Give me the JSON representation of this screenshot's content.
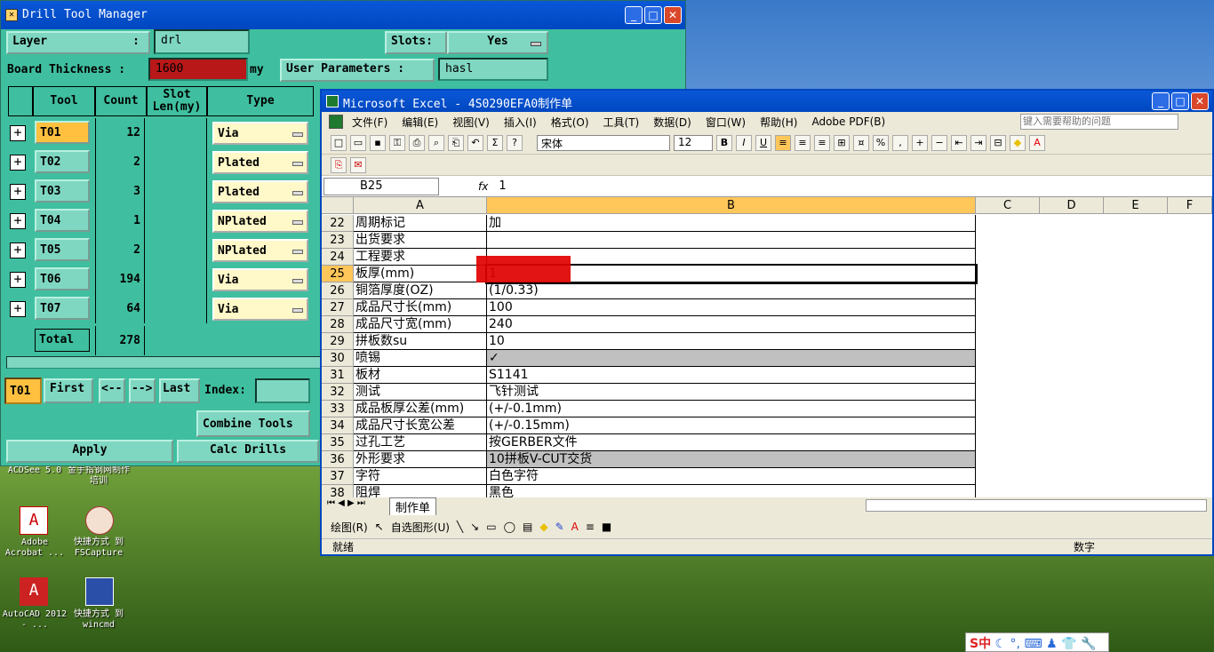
{
  "desktop": {
    "icons": [
      {
        "label": "ACDSee 5.0"
      },
      {
        "label": "金手指钢网制作培训"
      },
      {
        "label": "Adobe Acrobat ..."
      },
      {
        "label": "快捷方式 到 FSCapture"
      },
      {
        "label": "AutoCAD 2012 - ..."
      },
      {
        "label": "快捷方式 到 wincmd"
      }
    ],
    "tray": "S中"
  },
  "drill": {
    "title": "Drill Tool Manager",
    "layer_label": "Layer",
    "layer_sep": ":",
    "layer_value": "drl",
    "slots_label": "Slots:",
    "slots_value": "Yes",
    "thickness_label": "Board Thickness :",
    "thickness_value": "1600",
    "thickness_unit": "my",
    "user_params_label": "User Parameters :",
    "user_params_value": "hasl",
    "headers": {
      "tool": "Tool",
      "count": "Count",
      "slot": "Slot Len(my)",
      "type": "Type"
    },
    "rows": [
      {
        "tool": "T01",
        "count": "12",
        "type": "Via"
      },
      {
        "tool": "T02",
        "count": "2",
        "type": "Plated"
      },
      {
        "tool": "T03",
        "count": "3",
        "type": "Plated"
      },
      {
        "tool": "T04",
        "count": "1",
        "type": "NPlated"
      },
      {
        "tool": "T05",
        "count": "2",
        "type": "NPlated"
      },
      {
        "tool": "T06",
        "count": "194",
        "type": "Via"
      },
      {
        "tool": "T07",
        "count": "64",
        "type": "Via"
      }
    ],
    "total_label": "Total",
    "total_count": "278",
    "current_tool": "T01",
    "nav": {
      "first": "First",
      "prev": "<--",
      "next": "-->",
      "last": "Last",
      "index_label": "Index:"
    },
    "combine": "Combine Tools",
    "apply": "Apply",
    "calc": "Calc Drills"
  },
  "excel": {
    "title": "Microsoft Excel - 4S0290EFA0制作单",
    "menu": [
      "文件(F)",
      "编辑(E)",
      "视图(V)",
      "插入(I)",
      "格式(O)",
      "工具(T)",
      "数据(D)",
      "窗口(W)",
      "帮助(H)",
      "Adobe PDF(B)"
    ],
    "help_placeholder": "键入需要帮助的问题",
    "font": "宋体",
    "font_size": "12",
    "name_box": "B25",
    "fx": "fx",
    "formula": "1",
    "columns": [
      "A",
      "B",
      "C",
      "D",
      "E",
      "F"
    ],
    "rows": [
      {
        "n": "22",
        "a": "周期标记",
        "b": "加"
      },
      {
        "n": "23",
        "a": "出货要求",
        "b": ""
      },
      {
        "n": "24",
        "a": "工程要求",
        "b": ""
      },
      {
        "n": "25",
        "a": "板厚(mm)",
        "b": "1"
      },
      {
        "n": "26",
        "a": "铜箔厚度(OZ)",
        "b": "(1/0.33)"
      },
      {
        "n": "27",
        "a": "成品尺寸长(mm)",
        "b": "100"
      },
      {
        "n": "28",
        "a": "成品尺寸宽(mm)",
        "b": "240"
      },
      {
        "n": "29",
        "a": "拼板数su",
        "b": "10"
      },
      {
        "n": "30",
        "a": "喷锡",
        "b": "✓"
      },
      {
        "n": "31",
        "a": "板材",
        "b": "S1141"
      },
      {
        "n": "32",
        "a": "测试",
        "b": "飞针测试"
      },
      {
        "n": "33",
        "a": "成品板厚公差(mm)",
        "b": "(+/-0.1mm)"
      },
      {
        "n": "34",
        "a": "成品尺寸长宽公差",
        "b": "(+/-0.15mm)"
      },
      {
        "n": "35",
        "a": "过孔工艺",
        "b": "按GERBER文件"
      },
      {
        "n": "36",
        "a": "外形要求",
        "b": "10拼板V-CUT交货"
      },
      {
        "n": "37",
        "a": "字符",
        "b": "白色字符"
      },
      {
        "n": "38",
        "a": "阻焊",
        "b": "黑色"
      }
    ],
    "sheet_tab": "制作单",
    "draw_label": "绘图(R)",
    "autoshape_label": "自选图形(U)",
    "status": "就绪",
    "status_right": "数字"
  }
}
